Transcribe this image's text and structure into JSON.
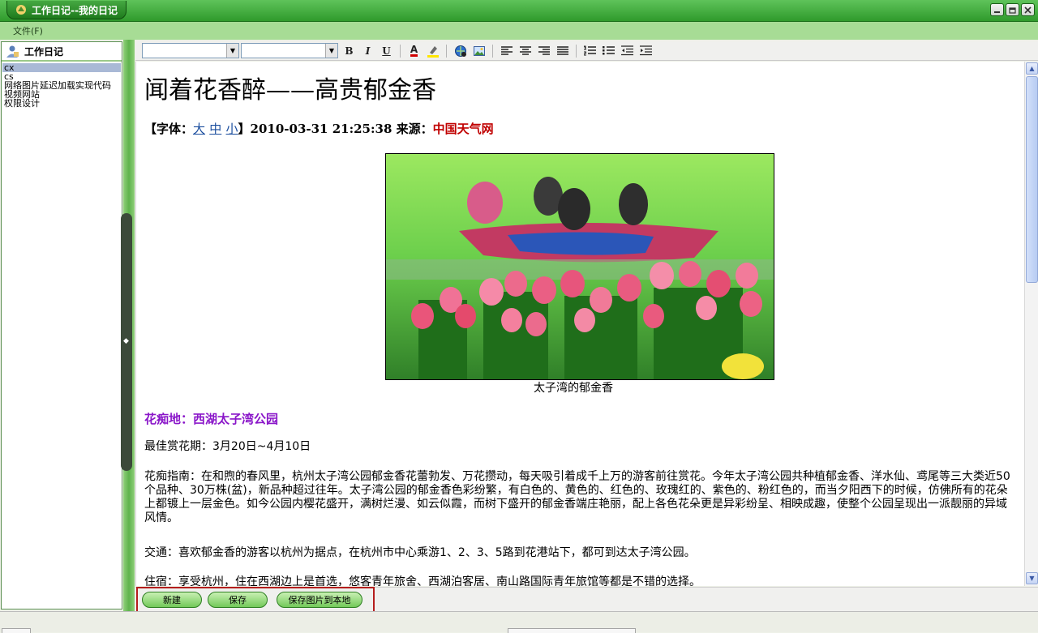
{
  "window": {
    "title": "工作日记--我的日记",
    "controls": [
      "minimize-icon",
      "restore-icon",
      "close-icon"
    ]
  },
  "menu": {
    "items": [
      "文件(F)"
    ]
  },
  "sidebar": {
    "tab_title": "工作日记",
    "items": [
      {
        "label": "cx",
        "selected": true
      },
      {
        "label": "cs",
        "selected": false
      },
      {
        "label": "网络图片延迟加载实现代码",
        "selected": false
      },
      {
        "label": "视频网站",
        "selected": false
      },
      {
        "label": "权限设计",
        "selected": false
      }
    ]
  },
  "toolbar": {
    "font_value": "",
    "size_value": "",
    "buttons": [
      "bold-icon",
      "italic-icon",
      "underline-icon",
      "font-color-icon",
      "highlight-icon",
      "link-icon",
      "image-icon",
      "align-left-icon",
      "align-center-icon",
      "align-right-icon",
      "justify-icon",
      "ordered-list-icon",
      "unordered-list-icon",
      "outdent-icon",
      "indent-icon"
    ],
    "bold_glyph": "B",
    "italic_glyph": "I",
    "underline_glyph": "U",
    "fontcolor_glyph": "A"
  },
  "article": {
    "title": "闻着花香醉——高贵郁金香",
    "meta_prefix": "【字体：",
    "size_large": "大",
    "size_medium": "中",
    "size_small": "小",
    "meta_mid": "】2010-03-31 21:25:38  来源：",
    "source": "中国天气网",
    "caption": "太子湾的郁金香",
    "section_heading": "花痴地：西湖太子湾公园",
    "p1": "最佳赏花期：3月20日~4月10日",
    "p2": "花痴指南：在和煦的春风里，杭州太子湾公园郁金香花蕾勃发、万花攒动，每天吸引着成千上万的游客前往赏花。今年太子湾公园共种植郁金香、洋水仙、鸢尾等三大类近50个品种、30万株(盆)，新品种超过往年。太子湾公园的郁金香色彩纷繁，有白色的、黄色的、红色的、玫瑰红的、紫色的、粉红色的，而当夕阳西下的时候，仿佛所有的花朵上都镀上一层金色。如今公园内樱花盛开，满树烂漫、如云似霞，而树下盛开的郁金香端庄艳丽，配上各色花朵更是异彩纷呈、相映成趣，使整个公园呈现出一派靓丽的异域风情。",
    "p3": "交通：喜欢郁金香的游客以杭州为据点，在杭州市中心乘游1、2、3、5路到花港站下，都可到达太子湾公园。",
    "p4": "住宿：享受杭州，住在西湖边上是首选，悠客青年旅舍、西湖泊客居、南山路国际青年旅馆等都是不错的选择。"
  },
  "buttons": {
    "new_label": "新建",
    "save_label": "保存",
    "save_images_label": "保存图片到本地"
  },
  "colors": {
    "titlebar": "#2f9a2c",
    "menubar": "#a7dc95",
    "source_link": "#c00000",
    "section_heading": "#8a16c9",
    "highlight_frame": "#b51d1d"
  }
}
